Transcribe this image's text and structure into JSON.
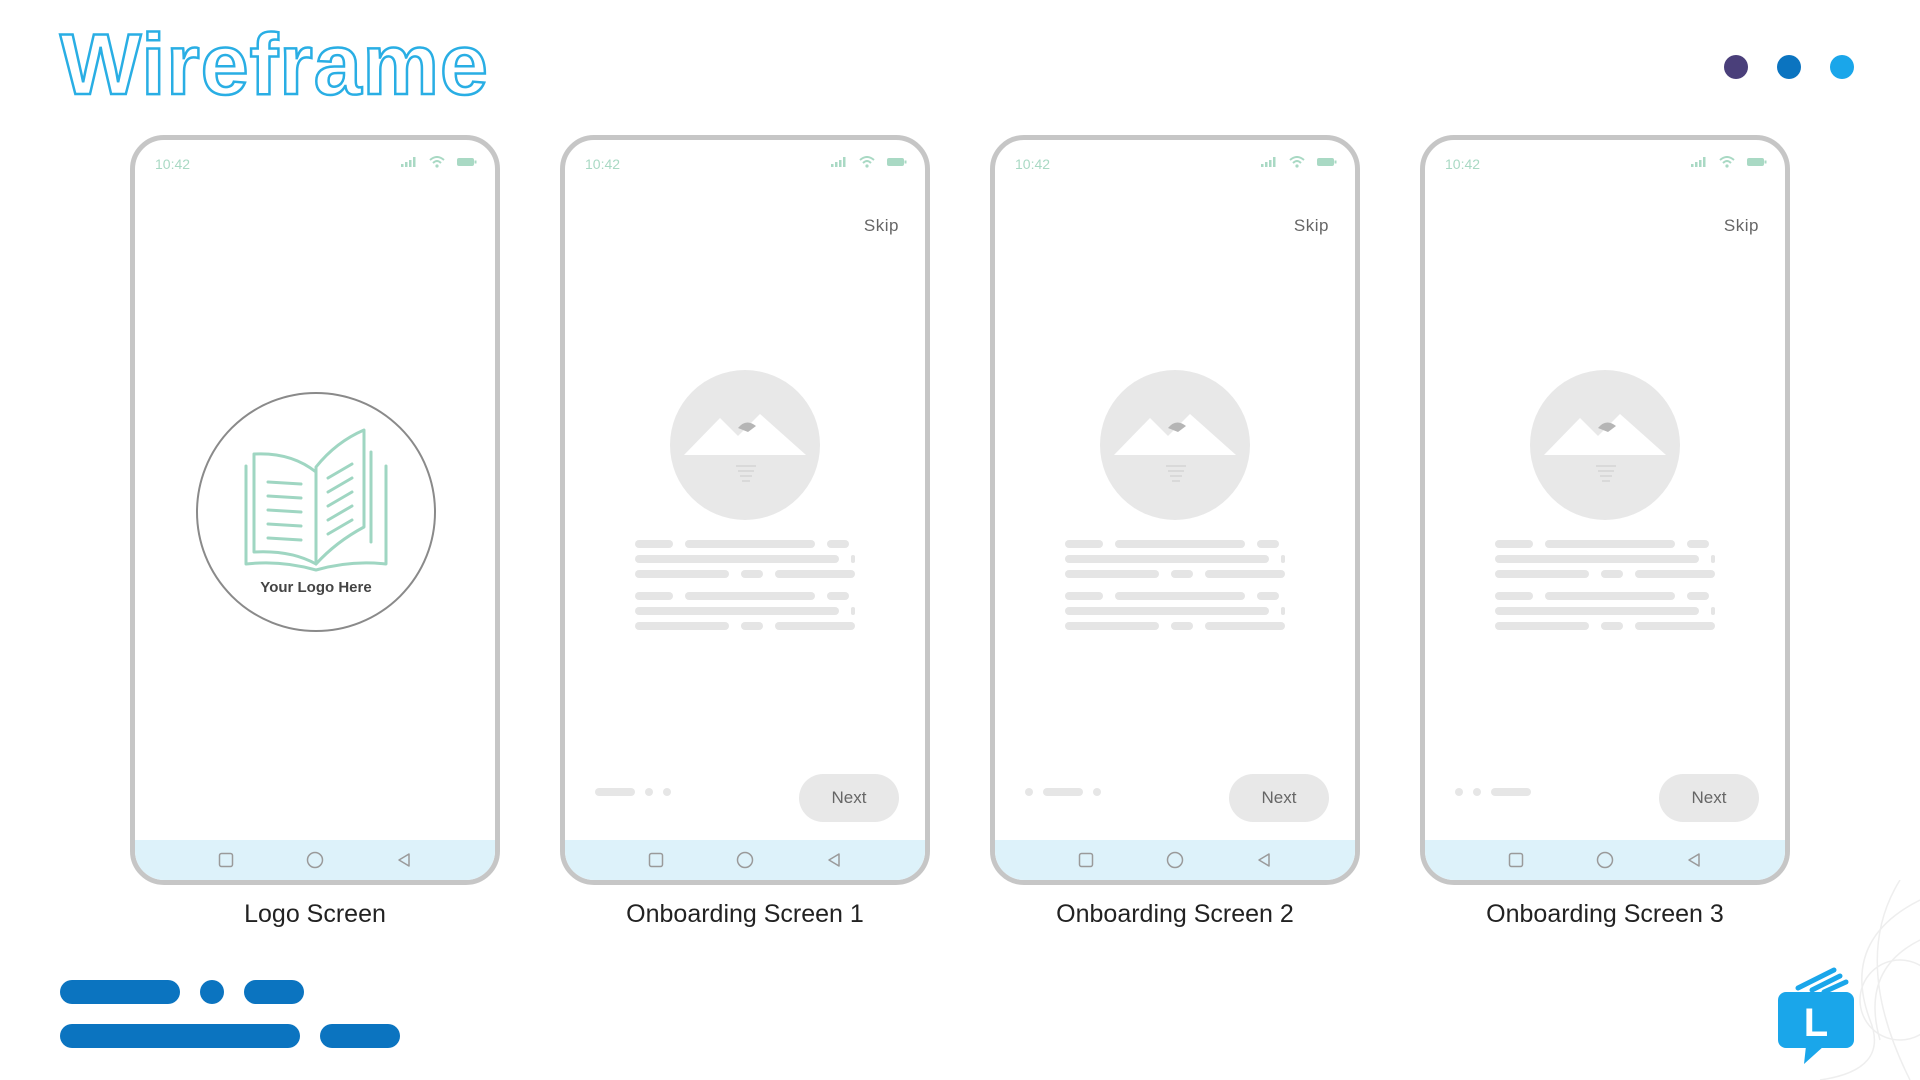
{
  "title": "Wireframe",
  "colors": {
    "title_stroke": "#29aee4",
    "dot_1": "#4a3f7a",
    "dot_2": "#0b74c0",
    "dot_3": "#1aa6ea",
    "accent_bar": "#0b74c0",
    "nav_bar": "#ddf2fa",
    "status_green": "#a9d9c4",
    "logo_line": "#9fd6c2"
  },
  "phones": [
    {
      "caption": "Logo Screen",
      "time": "10:42",
      "logo_text": "Your Logo Here",
      "icons": [
        "signal-icon",
        "wifi-icon",
        "battery-icon",
        "recent-apps-icon",
        "home-icon",
        "back-icon"
      ]
    },
    {
      "caption": "Onboarding Screen 1",
      "time": "10:42",
      "skip": "Skip",
      "next": "Next",
      "active_page": 1,
      "icons": [
        "signal-icon",
        "wifi-icon",
        "battery-icon",
        "image-placeholder-icon",
        "recent-apps-icon",
        "home-icon",
        "back-icon"
      ]
    },
    {
      "caption": "Onboarding Screen 2",
      "time": "10:42",
      "skip": "Skip",
      "next": "Next",
      "active_page": 2,
      "icons": [
        "signal-icon",
        "wifi-icon",
        "battery-icon",
        "image-placeholder-icon",
        "recent-apps-icon",
        "home-icon",
        "back-icon"
      ]
    },
    {
      "caption": "Onboarding Screen 3",
      "time": "10:42",
      "skip": "Skip",
      "next": "Next",
      "active_page": 3,
      "icons": [
        "signal-icon",
        "wifi-icon",
        "battery-icon",
        "image-placeholder-icon",
        "recent-apps-icon",
        "home-icon",
        "back-icon"
      ]
    }
  ],
  "brand": {
    "letter": "L",
    "icon": "chat-bubble-logo-icon"
  }
}
